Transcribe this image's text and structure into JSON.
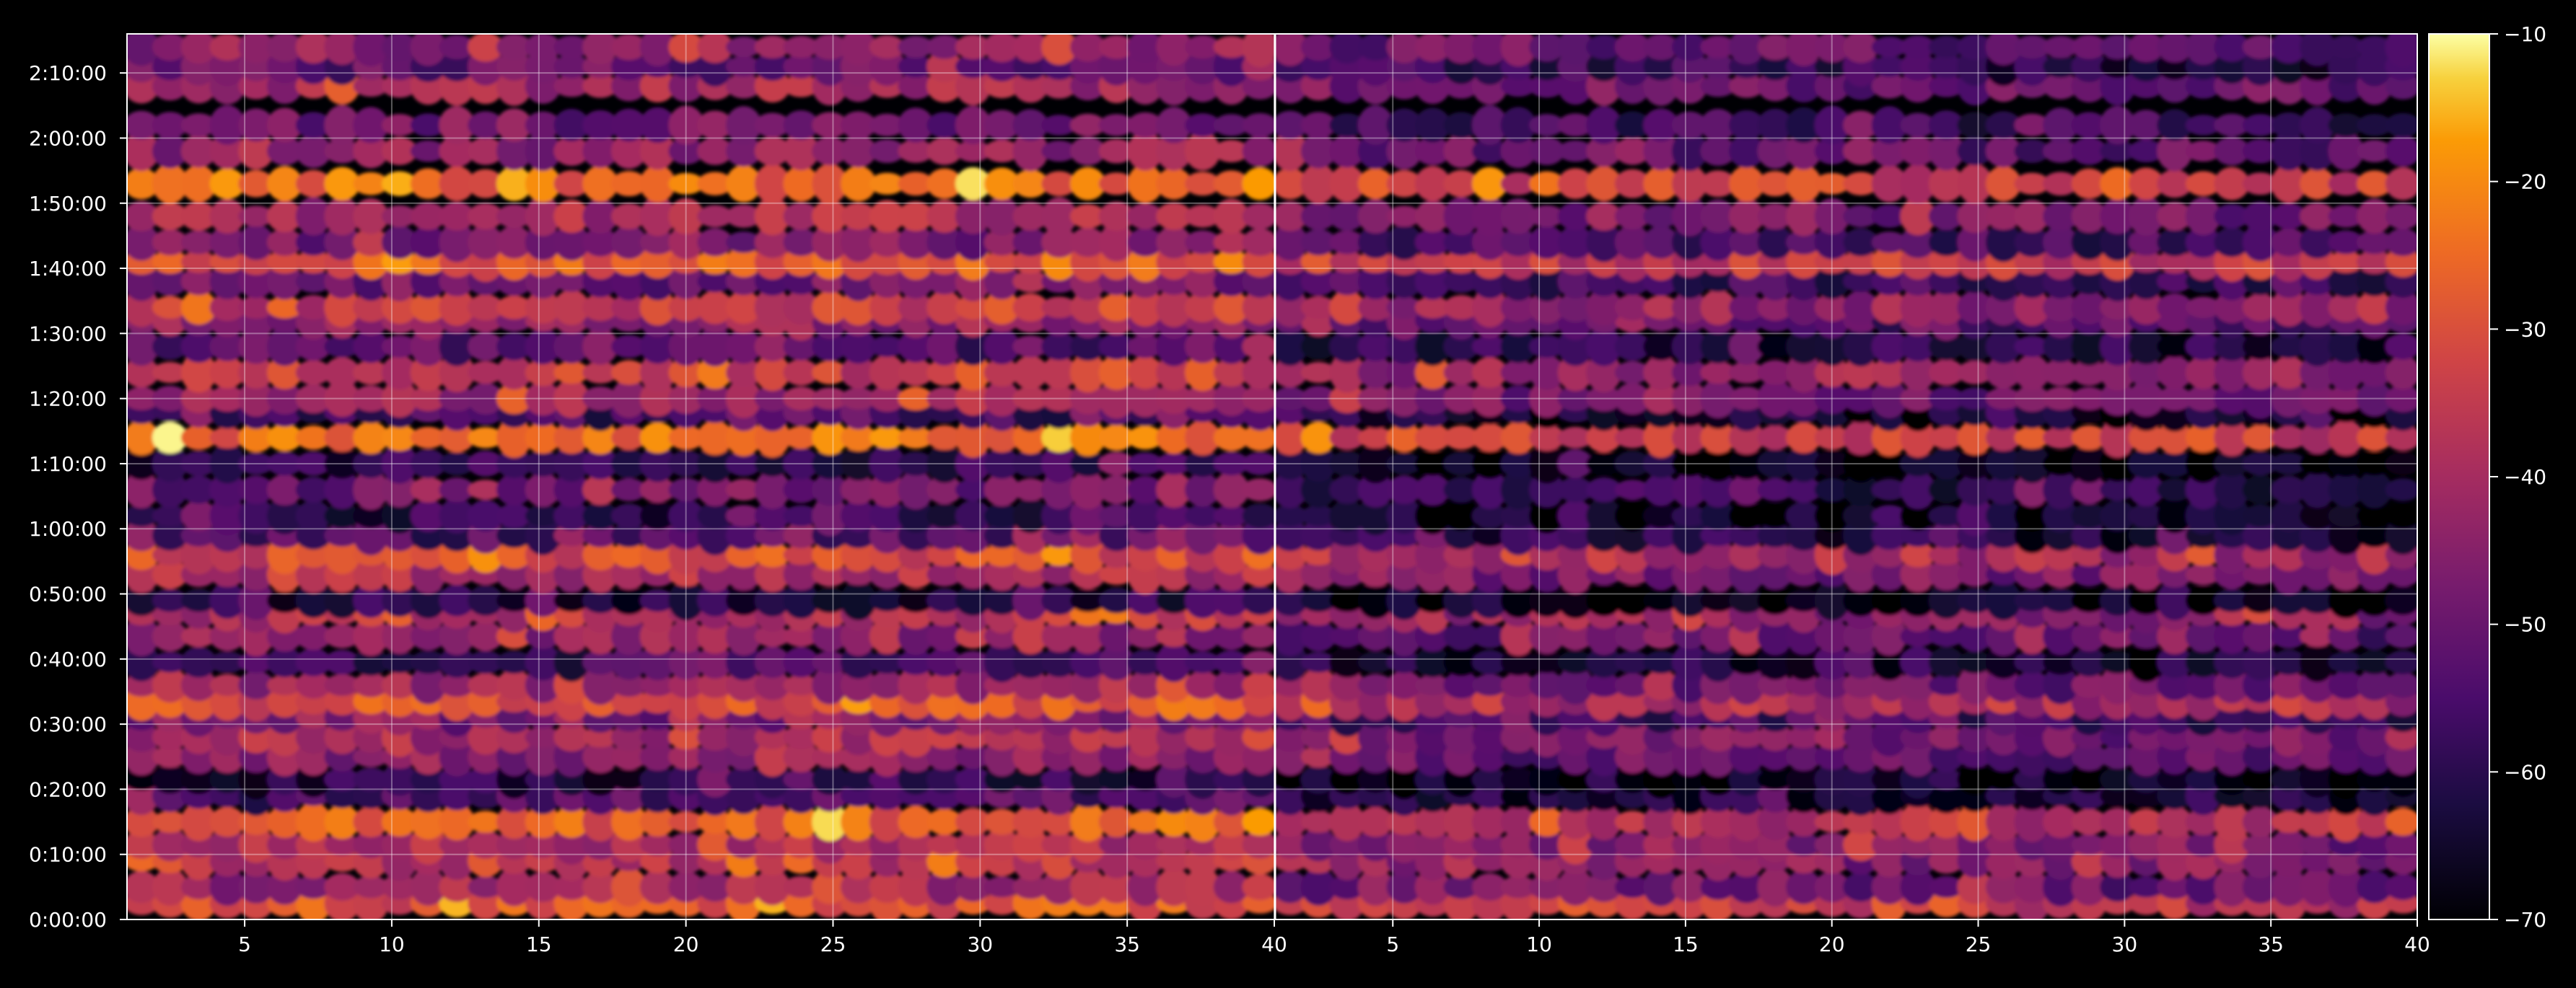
{
  "chart_data": {
    "type": "heatmap",
    "title": "",
    "xlabel": "",
    "ylabel": "",
    "grid": true,
    "colormap": "inferno",
    "panels": [
      {
        "name": "",
        "xlim": [
          1,
          40
        ],
        "xticks": [
          5,
          10,
          15,
          20,
          25,
          30,
          35,
          40
        ],
        "x_tick_labels": [
          "5",
          "10",
          "15",
          "20",
          "25",
          "30",
          "35",
          "40"
        ]
      },
      {
        "name": "",
        "xlim": [
          1,
          40
        ],
        "xticks": [
          5,
          10,
          15,
          20,
          25,
          30,
          35,
          40
        ],
        "x_tick_labels": [
          "5",
          "10",
          "15",
          "20",
          "25",
          "30",
          "35",
          "40"
        ]
      }
    ],
    "y_range_seconds": [
      0,
      8160
    ],
    "y_ticks_seconds": [
      0,
      600,
      1200,
      1800,
      2400,
      3000,
      3600,
      4200,
      4800,
      5400,
      6000,
      6600,
      7200,
      7800
    ],
    "y_tick_labels": [
      "0:00:00",
      "0:10:00",
      "0:20:00",
      "0:30:00",
      "0:40:00",
      "0:50:00",
      "1:00:00",
      "1:10:00",
      "1:20:00",
      "1:30:00",
      "1:40:00",
      "1:50:00",
      "2:00:00",
      "2:10:00"
    ],
    "colorbar": {
      "range": [
        -70,
        -10
      ],
      "ticks": [
        -70,
        -60,
        -50,
        -40,
        -30,
        -20,
        -10
      ],
      "tick_labels": [
        "−70",
        "−60",
        "−50",
        "−40",
        "−30",
        "−20",
        "−10"
      ]
    },
    "band_profile": {
      "description": "",
      "rows_time_seconds": [
        150,
        300,
        540,
        690,
        900,
        1140,
        1290,
        1500,
        1680,
        1860,
        2010,
        2160,
        2370,
        2610,
        2820,
        2940,
        3180,
        3360,
        3540,
        3720,
        3960,
        4200,
        4440,
        4680,
        4800,
        5040,
        5280,
        5520,
        5640,
        5880,
        6060,
        6240,
        6480,
        6780,
        7080,
        7320,
        7680,
        7860,
        8040
      ],
      "panel_1_level": [
        -30,
        -42,
        -38,
        -40,
        -28,
        -55,
        -62,
        -45,
        -40,
        -48,
        -30,
        -42,
        -58,
        -45,
        -38,
        -62,
        -40,
        -32,
        -55,
        -60,
        -50,
        -60,
        -25,
        -58,
        -42,
        -35,
        -55,
        -45,
        -35,
        -50,
        -28,
        -48,
        -40,
        -26,
        -45,
        -50,
        -42,
        -52,
        -44
      ],
      "panel_2_level": [
        -35,
        -48,
        -45,
        -45,
        -36,
        -62,
        -66,
        -50,
        -46,
        -55,
        -38,
        -48,
        -62,
        -50,
        -42,
        -66,
        -46,
        -38,
        -60,
        -65,
        -58,
        -66,
        -32,
        -64,
        -48,
        -42,
        -60,
        -52,
        -42,
        -56,
        -34,
        -54,
        -46,
        -32,
        -50,
        -56,
        -48,
        -58,
        -50
      ],
      "column_gradient": [
        0,
        0.1,
        0.2,
        0.3,
        0.4,
        0.5,
        0.6,
        0.7,
        0.8,
        0.9,
        1.0
      ]
    }
  }
}
